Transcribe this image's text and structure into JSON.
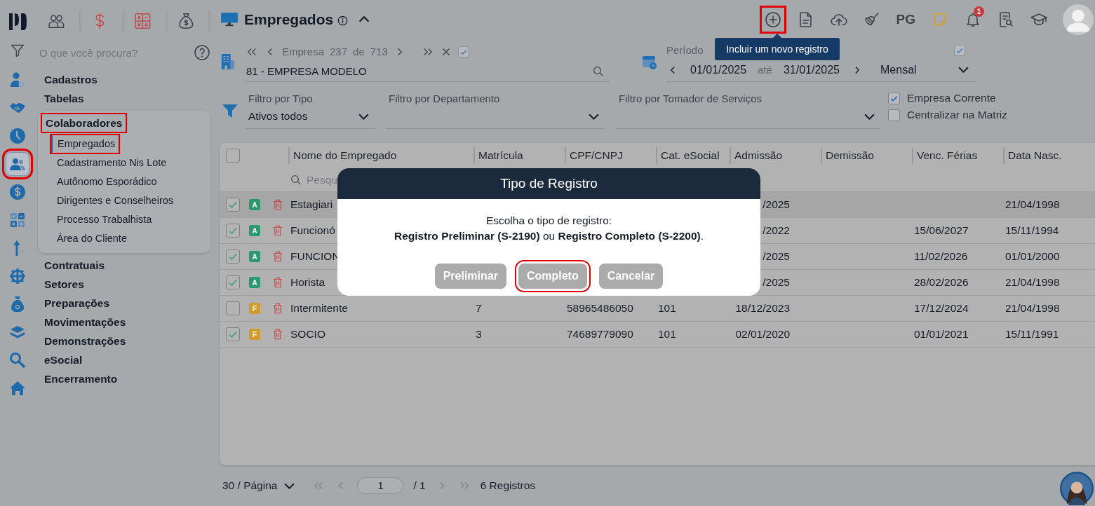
{
  "rail": {
    "items": [
      {
        "kind": "person-gear",
        "selected": false,
        "annotated": false
      },
      {
        "kind": "handshake",
        "selected": false,
        "annotated": false
      },
      {
        "kind": "clock",
        "selected": false,
        "annotated": false
      },
      {
        "kind": "people",
        "selected": true,
        "annotated": true
      },
      {
        "kind": "dollar",
        "selected": false,
        "annotated": false
      },
      {
        "kind": "calculator",
        "selected": false,
        "annotated": false
      },
      {
        "kind": "arrow-pen",
        "selected": false,
        "annotated": false
      },
      {
        "kind": "gear",
        "selected": false,
        "annotated": false
      },
      {
        "kind": "bag",
        "selected": false,
        "annotated": false
      },
      {
        "kind": "layers",
        "selected": false,
        "annotated": false
      },
      {
        "kind": "search",
        "selected": false,
        "annotated": false
      },
      {
        "kind": "home",
        "selected": false,
        "annotated": false
      }
    ]
  },
  "module_tabs": [
    {
      "kind": "people",
      "color": "#3d4248"
    },
    {
      "kind": "dollar",
      "color": "#c8474c"
    },
    {
      "kind": "calculator",
      "color": "#c8474c"
    },
    {
      "kind": "bag",
      "color": "#3d4248"
    }
  ],
  "search": {
    "placeholder": "O que você procura?"
  },
  "menu": [
    {
      "label": "Cadastros",
      "annotated": false
    },
    {
      "label": "Tabelas",
      "annotated": false
    },
    {
      "label": "Colaboradores",
      "annotated": true,
      "children": [
        {
          "label": "Empregados",
          "selected": true,
          "annotated": true
        },
        {
          "label": "Cadastramento Nis Lote",
          "selected": false,
          "annotated": false
        },
        {
          "label": "Autônomo Esporádico",
          "selected": false,
          "annotated": false
        },
        {
          "label": "Dirigentes e Conselheiros",
          "selected": false,
          "annotated": false
        },
        {
          "label": "Processo Trabalhista",
          "selected": false,
          "annotated": false
        },
        {
          "label": "Área do Cliente",
          "selected": false,
          "annotated": false
        }
      ]
    },
    {
      "label": "Contratuais",
      "annotated": false
    },
    {
      "label": "Setores",
      "annotated": false
    },
    {
      "label": "Preparações",
      "annotated": false
    },
    {
      "label": "Movimentações",
      "annotated": false
    },
    {
      "label": "Demonstrações",
      "annotated": false
    },
    {
      "label": "eSocial",
      "annotated": false
    },
    {
      "label": "Encerramento",
      "annotated": false
    }
  ],
  "header": {
    "title": "Empregados",
    "toolbar": [
      {
        "kind": "plus",
        "annotated": true
      },
      {
        "kind": "document",
        "annotated": false
      },
      {
        "kind": "cloud-upload",
        "annotated": false
      },
      {
        "kind": "broom",
        "annotated": false
      },
      {
        "kind": "text",
        "text": "PG",
        "annotated": false
      },
      {
        "kind": "note",
        "annotated": false
      },
      {
        "kind": "bell",
        "badge": "1",
        "annotated": false
      },
      {
        "kind": "doc-search",
        "annotated": false
      },
      {
        "kind": "cap",
        "annotated": false
      }
    ],
    "tooltip": "Incluir um novo registro"
  },
  "empresa": {
    "label": "Empresa",
    "index": "237",
    "of": "de",
    "total": "713",
    "checked": true,
    "value": "81 - EMPRESA MODELO"
  },
  "periodo": {
    "label": "Período",
    "from": "01/01/2025",
    "until": "até",
    "to": "31/01/2025",
    "mode": "Mensal",
    "checked": true
  },
  "filters": [
    {
      "label": "Filtro por Tipo",
      "value": "Ativos todos"
    },
    {
      "label": "Filtro por Departamento"
    },
    {
      "label": "Filtro por Tomador de Serviços"
    }
  ],
  "options": [
    {
      "label": "Empresa Corrente",
      "checked": true
    },
    {
      "label": "Centralizar na Matriz",
      "checked": false
    }
  ],
  "table": {
    "all_checked": false,
    "search_placeholder": "Pesqu",
    "columns": [
      "Nome do Empregado",
      "Matrícula",
      "CPF/CNPJ",
      "Cat. eSocial",
      "Admissão",
      "Demissão",
      "Venc. Férias",
      "Data Nasc."
    ],
    "rows": [
      {
        "checked": true,
        "badge": {
          "text": "A",
          "color": "#2a9a6e"
        },
        "name": "Estagiari",
        "admissao": "/2025",
        "nasc": "21/04/1998"
      },
      {
        "checked": true,
        "badge": {
          "text": "A",
          "color": "#2a9a6e"
        },
        "name": "Funcionó",
        "admissao": "/2022",
        "venc": "15/06/2027",
        "nasc": "15/11/1994"
      },
      {
        "checked": true,
        "badge": {
          "text": "A",
          "color": "#2a9a6e"
        },
        "name": "FUNCION",
        "admissao": "/2025",
        "venc": "11/02/2026",
        "nasc": "01/01/2000"
      },
      {
        "checked": true,
        "badge": {
          "text": "A",
          "color": "#2a9a6e"
        },
        "name": "Horista",
        "admissao": "/2025",
        "venc": "28/02/2026",
        "nasc": "21/04/1998"
      },
      {
        "checked": false,
        "badge": {
          "text": "F",
          "color": "#d39a2e"
        },
        "name": "Intermitente",
        "matricula": "7",
        "cpf": "58965486050",
        "cat": "101",
        "admissao": "18/12/2023",
        "venc": "17/12/2024",
        "nasc": "21/04/1998"
      },
      {
        "checked": true,
        "badge": {
          "text": "F",
          "color": "#d39a2e"
        },
        "name": "SOCIO",
        "matricula": "3",
        "cpf": "74689779090",
        "cat": "101",
        "admissao": "02/01/2020",
        "venc": "01/01/2021",
        "nasc": "15/11/1991"
      }
    ]
  },
  "modal": {
    "title": "Tipo de Registro",
    "lines": [
      "Escolha o tipo de registro:",
      "**Registro Preliminar (S-2190)** ou **Registro Completo (S-2200)**."
    ],
    "buttons": [
      {
        "label": "Preliminar",
        "annotated": false
      },
      {
        "label": "Completo",
        "annotated": true
      },
      {
        "label": "Cancelar",
        "annotated": false
      }
    ]
  },
  "pagination": {
    "page_size": "30 / Página",
    "page": "1",
    "pages": "/ 1",
    "total": "6 Registros"
  }
}
